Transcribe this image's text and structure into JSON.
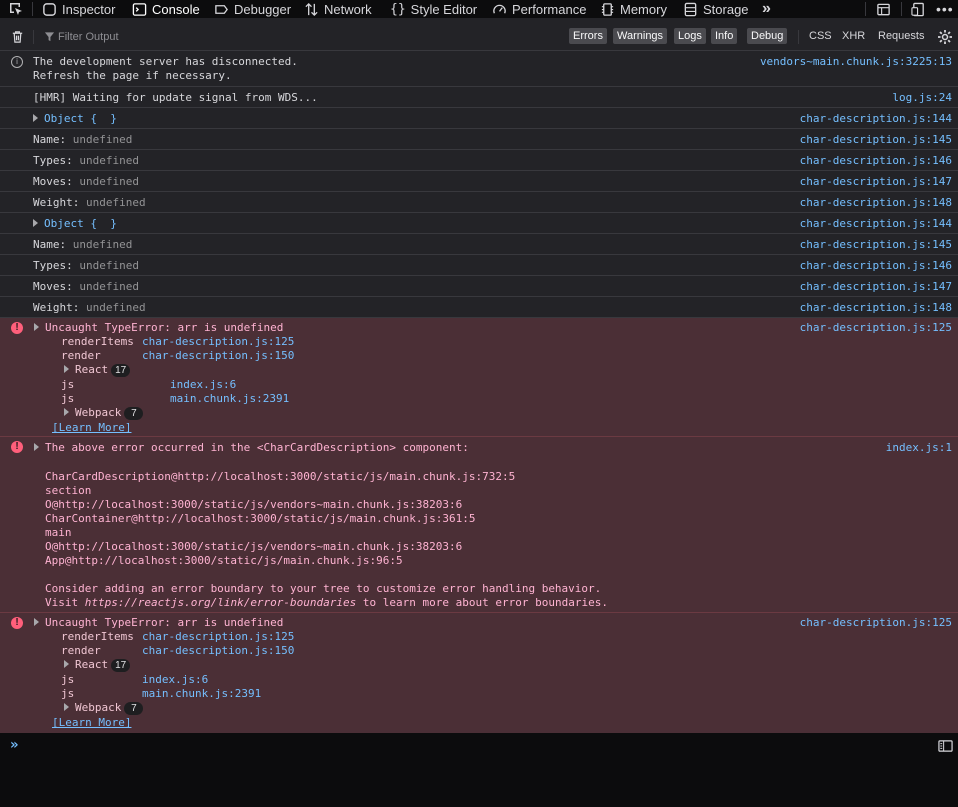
{
  "toolbar": {
    "tabs": [
      {
        "label": "Inspector",
        "icon": "inspector-icon"
      },
      {
        "label": "Console",
        "icon": "console-icon",
        "selected": true
      },
      {
        "label": "Debugger",
        "icon": "debugger-icon"
      },
      {
        "label": "Network",
        "icon": "network-icon"
      },
      {
        "label": "Style Editor",
        "icon": "style-editor-icon"
      },
      {
        "label": "Performance",
        "icon": "performance-icon"
      },
      {
        "label": "Memory",
        "icon": "memory-icon"
      },
      {
        "label": "Storage",
        "icon": "storage-icon"
      }
    ],
    "overflow_label": "»"
  },
  "filterbar": {
    "placeholder": "Filter Output",
    "levels": [
      "Errors",
      "Warnings",
      "Logs",
      "Info",
      "Debug"
    ],
    "network": [
      "CSS",
      "XHR",
      "Requests"
    ]
  },
  "messages": {
    "m0": {
      "text1": "The development server has disconnected.",
      "text2": "Refresh the page if necessary.",
      "loc": "vendors~main.chunk.js:3225:13"
    },
    "m1": {
      "text": "[HMR] Waiting for update signal from WDS...",
      "loc": "log.js:24"
    },
    "m2": {
      "text": "Object {  }",
      "loc": "char-description.js:144"
    },
    "m3": {
      "key": "Name:",
      "val": "undefined",
      "loc": "char-description.js:145"
    },
    "m4": {
      "key": "Types:",
      "val": "undefined",
      "loc": "char-description.js:146"
    },
    "m5": {
      "key": "Moves:",
      "val": "undefined",
      "loc": "char-description.js:147"
    },
    "m6": {
      "key": "Weight:",
      "val": "undefined",
      "loc": "char-description.js:148"
    },
    "m7": {
      "text": "Object {  }",
      "loc": "char-description.js:144"
    },
    "m8": {
      "key": "Name:",
      "val": "undefined",
      "loc": "char-description.js:145"
    },
    "m9": {
      "key": "Types:",
      "val": "undefined",
      "loc": "char-description.js:146"
    },
    "m10": {
      "key": "Moves:",
      "val": "undefined",
      "loc": "char-description.js:147"
    },
    "m11": {
      "key": "Weight:",
      "val": "undefined",
      "loc": "char-description.js:148"
    },
    "e1": {
      "text": "Uncaught TypeError: arr is undefined",
      "loc": "char-description.js:125",
      "stack": [
        {
          "fn": "renderItems",
          "loc": "char-description.js:125"
        },
        {
          "fn": "render",
          "loc": "char-description.js:150"
        },
        {
          "group": "React",
          "count": "17"
        },
        {
          "fn": "js",
          "loc": "index.js:6"
        },
        {
          "fn": "js",
          "loc": "main.chunk.js:2391"
        },
        {
          "group": "Webpack",
          "count": "7"
        }
      ],
      "learn": "[Learn More]"
    },
    "e2": {
      "text": "The above error occurred in the <CharCardDescription> component:",
      "loc": "index.js:1",
      "lines": [
        "CharCardDescription@http://localhost:3000/static/js/main.chunk.js:732:5",
        "section",
        "O@http://localhost:3000/static/js/vendors~main.chunk.js:38203:6",
        "CharContainer@http://localhost:3000/static/js/main.chunk.js:361:5",
        "main",
        "O@http://localhost:3000/static/js/vendors~main.chunk.js:38203:6",
        "App@http://localhost:3000/static/js/main.chunk.js:96:5"
      ],
      "consider": "Consider adding an error boundary to your tree to customize error handling behavior.",
      "visit_pre": "Visit ",
      "visit_url": "https://reactjs.org/link/error-boundaries",
      "visit_post": " to learn more about error boundaries."
    },
    "e3": {
      "text": "Uncaught TypeError: arr is undefined",
      "loc": "char-description.js:125",
      "stack": [
        {
          "fn": "renderItems",
          "loc": "char-description.js:125"
        },
        {
          "fn": "render",
          "loc": "char-description.js:150"
        },
        {
          "group": "React",
          "count": "17"
        },
        {
          "fn": "js",
          "loc": "index.js:6"
        },
        {
          "fn": "js",
          "loc": "main.chunk.js:2391"
        },
        {
          "group": "Webpack",
          "count": "7"
        }
      ],
      "learn": "[Learn More]"
    }
  },
  "input": {
    "prompt": "»",
    "value": ""
  },
  "colors": {
    "accent": "#75bfff",
    "error_bg": "#4b2f36",
    "error_text": "#ffb3d2",
    "toolbar_bg": "#0c0c0d"
  }
}
